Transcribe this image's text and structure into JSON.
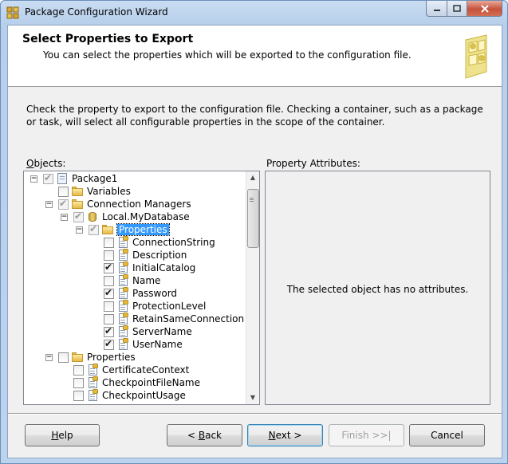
{
  "window": {
    "title": "Package Configuration Wizard"
  },
  "header": {
    "title": "Select Properties to Export",
    "subtitle": "You can select the properties which will be exported to the configuration file."
  },
  "description": "Check the property to export to the configuration file. Checking a container, such as a package or task, will select all configurable properties in the scope of the container.",
  "objects_label_first": "O",
  "objects_label_rest": "bjects:",
  "attributes_label": "Property Attributes:",
  "attributes_message": "The selected object has no attributes.",
  "tree": [
    {
      "label": "Package1",
      "level": 0,
      "expander": "−",
      "checked": true,
      "gray": true,
      "icon": "package-icon"
    },
    {
      "label": "Variables",
      "level": 1,
      "expander": null,
      "checked": false,
      "gray": false,
      "icon": "folder-icon"
    },
    {
      "label": "Connection Managers",
      "level": 1,
      "expander": "−",
      "checked": true,
      "gray": true,
      "icon": "folder-icon"
    },
    {
      "label": "Local.MyDatabase",
      "level": 2,
      "expander": "−",
      "checked": true,
      "gray": true,
      "icon": "database-icon"
    },
    {
      "label": "Properties",
      "level": 3,
      "expander": "−",
      "checked": true,
      "gray": true,
      "icon": "folder-icon",
      "selected": true
    },
    {
      "label": "ConnectionString",
      "level": 4,
      "expander": null,
      "checked": false,
      "gray": false,
      "icon": "property-icon"
    },
    {
      "label": "Description",
      "level": 4,
      "expander": null,
      "checked": false,
      "gray": false,
      "icon": "property-icon"
    },
    {
      "label": "InitialCatalog",
      "level": 4,
      "expander": null,
      "checked": true,
      "gray": false,
      "icon": "property-icon"
    },
    {
      "label": "Name",
      "level": 4,
      "expander": null,
      "checked": false,
      "gray": false,
      "icon": "property-icon"
    },
    {
      "label": "Password",
      "level": 4,
      "expander": null,
      "checked": true,
      "gray": false,
      "icon": "property-icon"
    },
    {
      "label": "ProtectionLevel",
      "level": 4,
      "expander": null,
      "checked": false,
      "gray": false,
      "icon": "property-icon"
    },
    {
      "label": "RetainSameConnection",
      "level": 4,
      "expander": null,
      "checked": false,
      "gray": false,
      "icon": "property-icon"
    },
    {
      "label": "ServerName",
      "level": 4,
      "expander": null,
      "checked": true,
      "gray": false,
      "icon": "property-icon"
    },
    {
      "label": "UserName",
      "level": 4,
      "expander": null,
      "checked": true,
      "gray": false,
      "icon": "property-icon"
    },
    {
      "label": "Properties",
      "level": 1,
      "expander": "−",
      "checked": false,
      "gray": false,
      "icon": "folder-icon"
    },
    {
      "label": "CertificateContext",
      "level": 2,
      "expander": null,
      "checked": false,
      "gray": false,
      "icon": "property-icon"
    },
    {
      "label": "CheckpointFileName",
      "level": 2,
      "expander": null,
      "checked": false,
      "gray": false,
      "icon": "property-icon"
    },
    {
      "label": "CheckpointUsage",
      "level": 2,
      "expander": null,
      "checked": false,
      "gray": false,
      "icon": "property-icon"
    }
  ],
  "buttons": {
    "help": {
      "mnemonic": "H",
      "rest": "elp"
    },
    "back": {
      "prefix": "< ",
      "mnemonic": "B",
      "rest": "ack"
    },
    "next": {
      "mnemonic": "N",
      "rest": "ext >"
    },
    "finish": "Finish >>|",
    "cancel": "Cancel"
  }
}
